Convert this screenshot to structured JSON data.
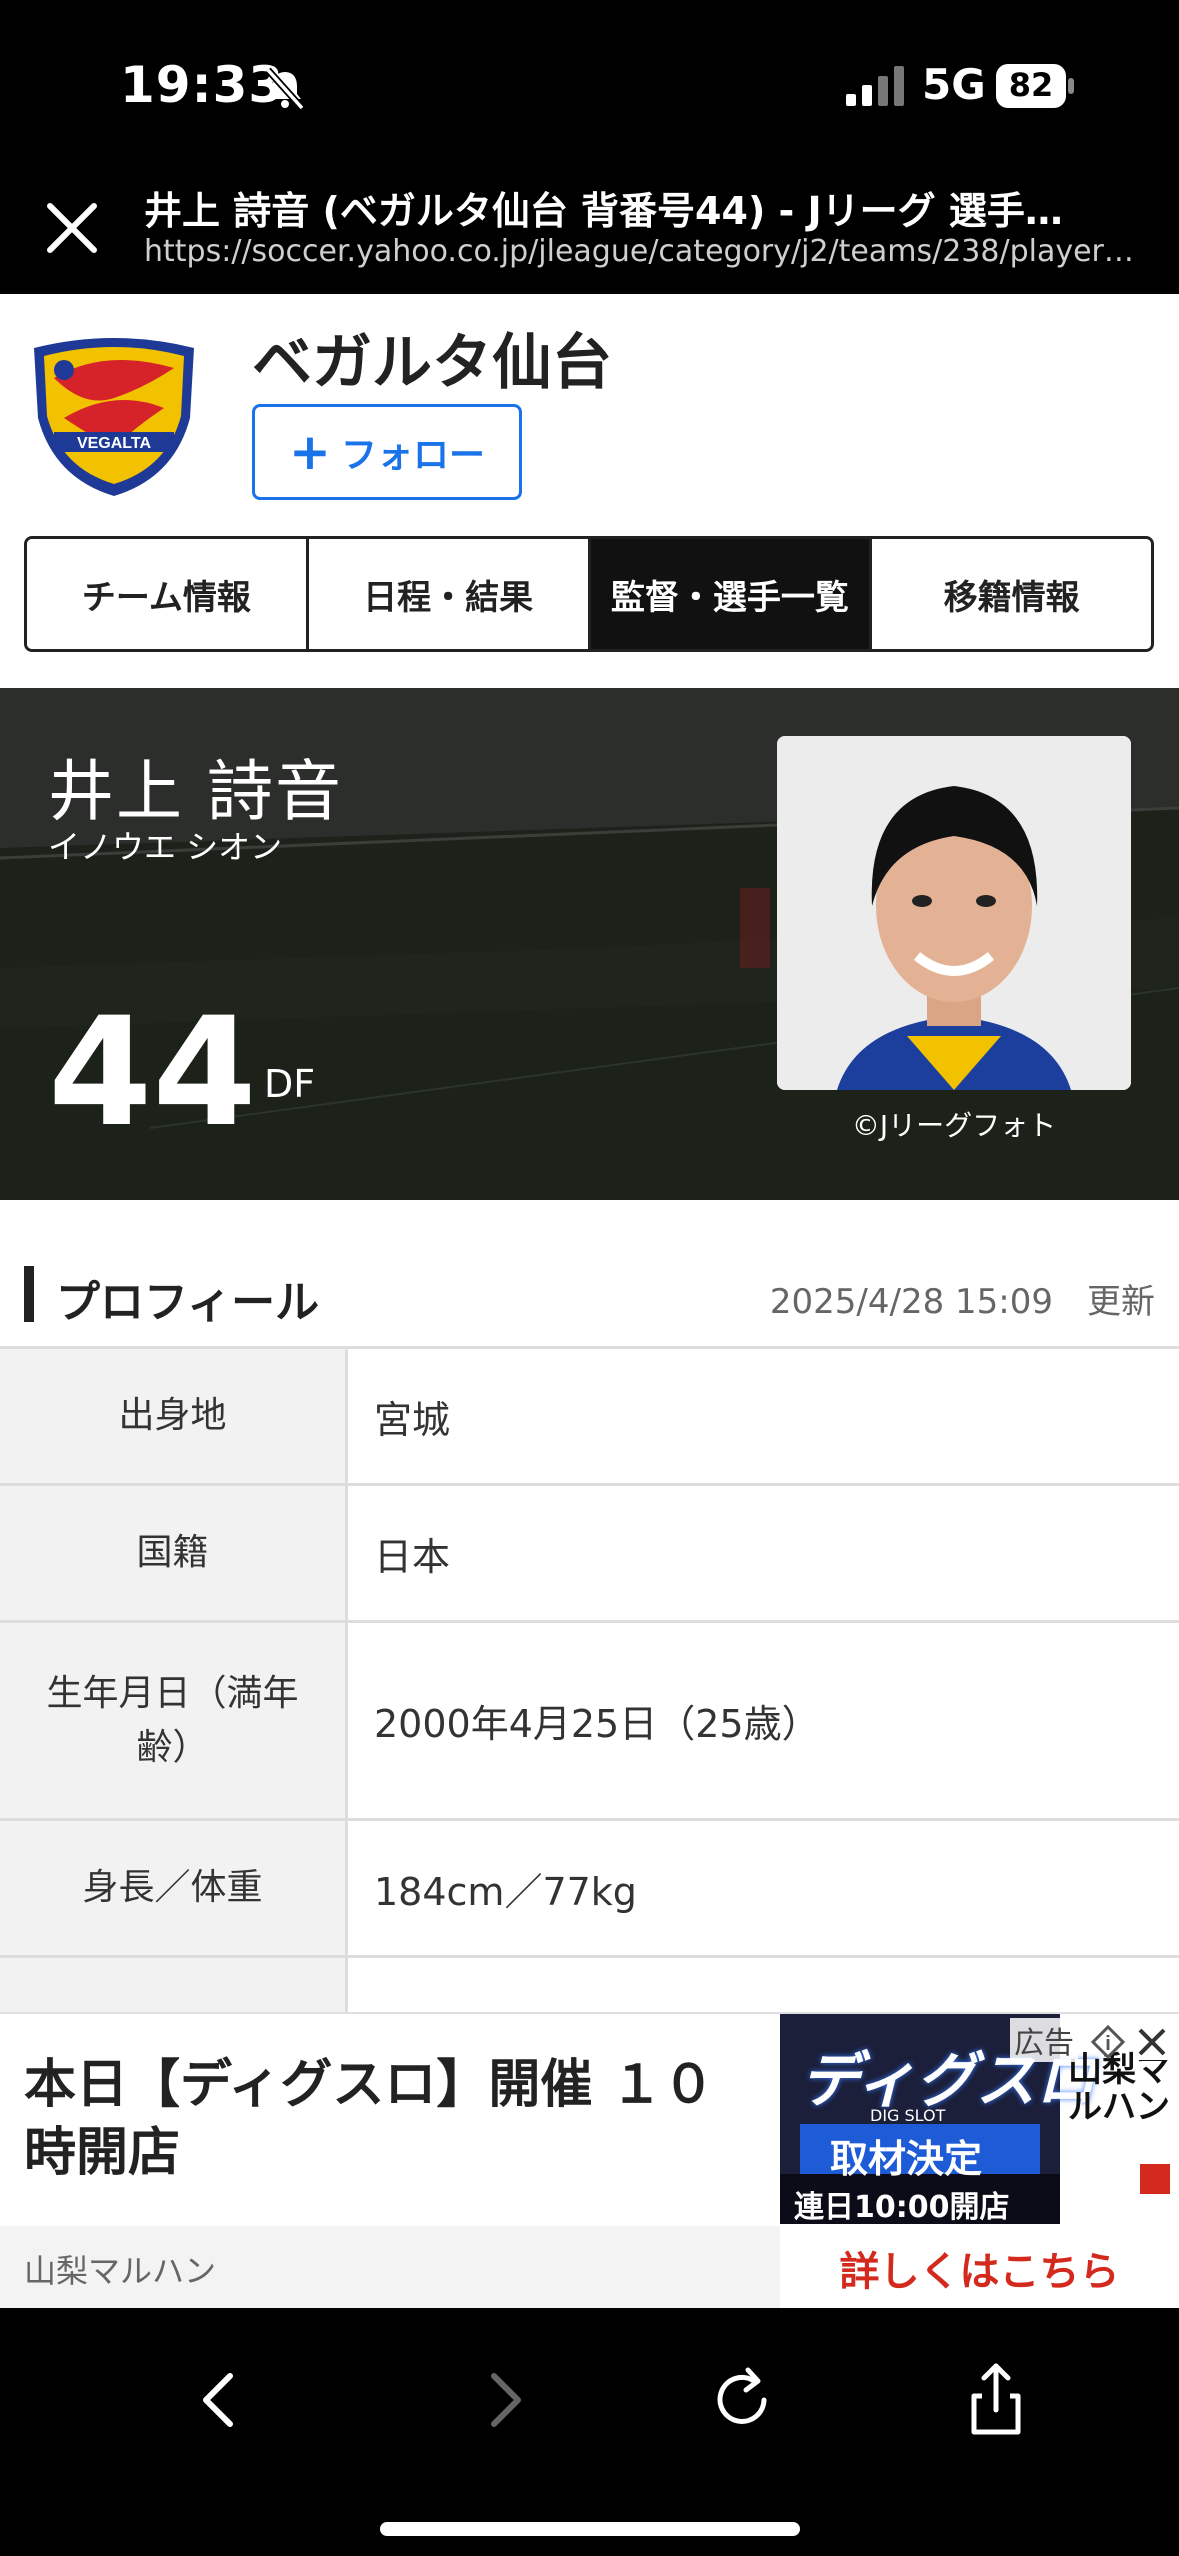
{
  "status_bar": {
    "time": "19:33",
    "network": "5G",
    "battery": "82"
  },
  "browser": {
    "page_title": "井上 詩音 (ベガルタ仙台 背番号44) - Jリーグ 選手…",
    "url": "https://soccer.yahoo.co.jp/jleague/category/j2/teams/238/players/1..."
  },
  "team": {
    "name": "ベガルタ仙台",
    "follow_label": "フォロー",
    "tabs": [
      {
        "label": "チーム情報",
        "active": false
      },
      {
        "label": "日程・結果",
        "active": false
      },
      {
        "label": "監督・選手一覧",
        "active": true
      },
      {
        "label": "移籍情報",
        "active": false
      }
    ]
  },
  "player": {
    "name": "井上 詩音",
    "kana": "イノウエ シオン",
    "number": "44",
    "position": "DF",
    "photo_credit": "©Jリーグフォト"
  },
  "profile": {
    "title": "プロフィール",
    "updated": "2025/4/28 15:09　更新",
    "rows": [
      {
        "label": "出身地",
        "value": "宮城"
      },
      {
        "label": "国籍",
        "value": "日本"
      },
      {
        "label": "生年月日（満年齢）",
        "value": "2000年4月25日（25歳）"
      },
      {
        "label": "身長／体重",
        "value": "184cm／77kg"
      }
    ]
  },
  "ad": {
    "text": "本日【ディグスロ】開催 １０時開店",
    "sponsor": "山梨マルハン",
    "cta": "詳しくはこちら",
    "label": "広告",
    "image_texts": {
      "logo": "ディグスロ",
      "sub": "DIG SLOT",
      "headline": "取材決定",
      "schedule": "連日10:00開店",
      "brand": "山梨マルハン"
    }
  },
  "colors": {
    "accent": "#1a73e8",
    "cta": "#d42a1e",
    "active_tab": "#111111"
  }
}
